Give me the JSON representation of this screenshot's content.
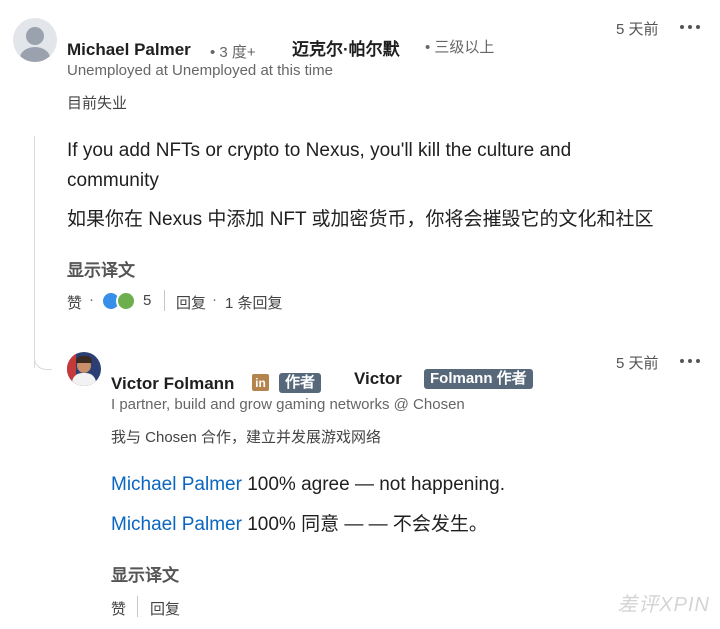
{
  "comment": {
    "author_name": "Michael Palmer",
    "degree": "• 3 度+",
    "author_name_cn": "迈克尔·帕尔默",
    "degree_cn": "• 三级以上",
    "headline": "Unemployed at Unemployed at this time",
    "headline_cn": "目前失业",
    "time": "5 天前",
    "body": "If you add NFTs or crypto to Nexus, you'll kill the culture and community",
    "body_cn": "如果你在 Nexus 中添加 NFT 或加密货币，你将会摧毁它的文化和社区",
    "show_translation": "显示译文",
    "like_label": "赞",
    "reaction_count": "5",
    "reply_label": "回复",
    "reply_count": "1 条回复"
  },
  "reply": {
    "author_name": "Victor Folmann",
    "linkedin_badge": "in",
    "author_tag": "作者",
    "author_name_cn_first": "Victor",
    "author_name_cn_tag": "Folmann 作者",
    "headline": "I partner, build and grow gaming networks @ Chosen",
    "headline_cn": "我与 Chosen 合作，建立并发展游戏网络",
    "time": "5 天前",
    "mention": "Michael Palmer",
    "body_rest": " 100% agree — not happening.",
    "body_cn_rest": " 100% 同意 — — 不会发生。",
    "show_translation": "显示译文",
    "like_label": "赞",
    "reply_label": "回复"
  },
  "watermark": "差评XPIN",
  "colors": {
    "mention": "#0a66c2",
    "author_tag_bg": "#56687a",
    "linkedin_badge_bg": "#b5834c",
    "reaction_like": "#378fe9",
    "reaction_support": "#6dae4f"
  },
  "icons": [
    "more-options-icon",
    "reaction-like-icon",
    "reaction-support-icon",
    "linkedin-icon"
  ]
}
